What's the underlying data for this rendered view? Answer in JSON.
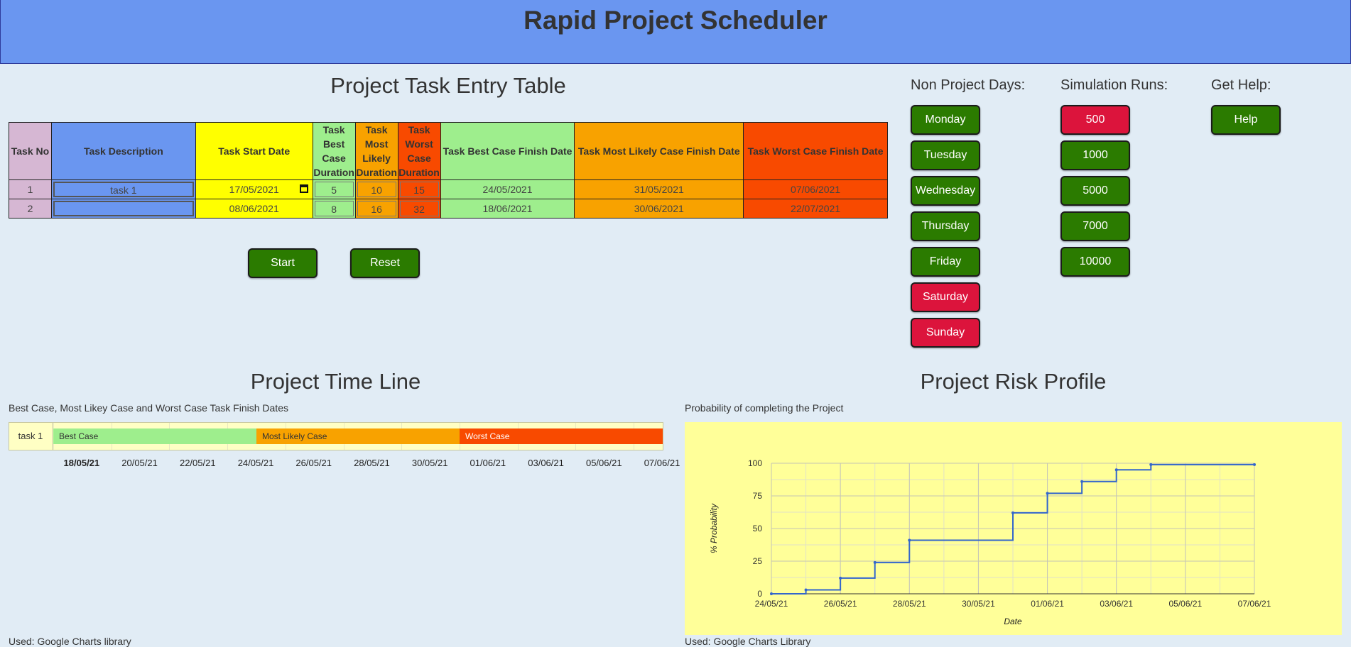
{
  "header": {
    "title": "Rapid Project Scheduler"
  },
  "task_table": {
    "title": "Project Task Entry Table",
    "columns": {
      "no": "Task No",
      "desc": "Task Description",
      "start": "Task Start Date",
      "best_l1": "Task",
      "best_l2": "Best",
      "best_l3": "Case",
      "best_l4": "Duration",
      "likely_l1": "Task",
      "likely_l2": "Most",
      "likely_l3": "Likely",
      "likely_l4": "Duration",
      "worst_l1": "Task",
      "worst_l2": "Worst",
      "worst_l3": "Case",
      "worst_l4": "Duration",
      "best_finish": "Task Best Case Finish Date",
      "likely_finish": "Task Most Likely Case Finish Date",
      "worst_finish": "Task Worst Case Finish Date"
    },
    "rows": [
      {
        "no": "1",
        "desc": "task 1",
        "start": "17/05/2021",
        "best": "5",
        "likely": "10",
        "worst": "15",
        "best_finish": "24/05/2021",
        "likely_finish": "31/05/2021",
        "worst_finish": "07/06/2021"
      },
      {
        "no": "2",
        "desc": "",
        "start": "08/06/2021",
        "best": "8",
        "likely": "16",
        "worst": "32",
        "best_finish": "18/06/2021",
        "likely_finish": "30/06/2021",
        "worst_finish": "22/07/2021"
      }
    ],
    "start_button": "Start",
    "reset_button": "Reset"
  },
  "non_project_days": {
    "title": "Non Project Days:",
    "days": [
      {
        "label": "Monday",
        "state": "on"
      },
      {
        "label": "Tuesday",
        "state": "on"
      },
      {
        "label": "Wednesday",
        "state": "on"
      },
      {
        "label": "Thursday",
        "state": "on"
      },
      {
        "label": "Friday",
        "state": "on"
      },
      {
        "label": "Saturday",
        "state": "off"
      },
      {
        "label": "Sunday",
        "state": "off"
      }
    ]
  },
  "simulation_runs": {
    "title": "Simulation Runs:",
    "options": [
      {
        "label": "500",
        "selected": true
      },
      {
        "label": "1000",
        "selected": false
      },
      {
        "label": "5000",
        "selected": false
      },
      {
        "label": "7000",
        "selected": false
      },
      {
        "label": "10000",
        "selected": false
      }
    ]
  },
  "help": {
    "title": "Get Help:",
    "button": "Help"
  },
  "timeline": {
    "title": "Project Time Line",
    "subtitle": "Best Case, Most Likey Case and Worst Case Task Finish Dates",
    "task_label": "task 1",
    "bars": [
      {
        "label": "Best Case",
        "start": "17/05/2021",
        "end": "24/05/2021",
        "color": "#9eee8d",
        "text_color": "#333333"
      },
      {
        "label": "Most Likely Case",
        "start": "24/05/2021",
        "end": "31/05/2021",
        "color": "#f8a200",
        "text_color": "#333333"
      },
      {
        "label": "Worst Case",
        "start": "31/05/2021",
        "end": "07/06/2021",
        "color": "#f84a00",
        "text_color": "#ffffff"
      }
    ],
    "axis_labels": [
      "18/05/21",
      "20/05/21",
      "22/05/21",
      "24/05/21",
      "26/05/21",
      "28/05/21",
      "30/05/21",
      "01/06/21",
      "03/06/21",
      "05/06/21",
      "07/06/21"
    ],
    "footer": "Used: Google Charts library"
  },
  "risk": {
    "title": "Project Risk Profile",
    "subtitle": "Probability of completing the Project",
    "footer": "Used: Google Charts Library"
  },
  "chart_data": {
    "type": "line",
    "title": "",
    "xlabel": "Date",
    "ylabel": "% Probability",
    "x_ticks": [
      "24/05/21",
      "26/05/21",
      "28/05/21",
      "30/05/21",
      "01/06/21",
      "03/06/21",
      "05/06/21",
      "07/06/21"
    ],
    "y_ticks": [
      0,
      25,
      50,
      75,
      100
    ],
    "ylim": [
      0,
      100
    ],
    "xlim": [
      "24/05/2021",
      "07/06/2021"
    ],
    "grid": true,
    "step": true,
    "line_color": "#3366cc",
    "background": "#ffff99",
    "series": [
      {
        "x": [
          "24/05/2021",
          "25/05/2021",
          "26/05/2021",
          "27/05/2021",
          "28/05/2021",
          "31/05/2021",
          "01/06/2021",
          "02/06/2021",
          "03/06/2021",
          "04/06/2021",
          "07/06/2021"
        ],
        "y": [
          0,
          3,
          12,
          24,
          41,
          62,
          77,
          86,
          95,
          99,
          99
        ]
      }
    ]
  }
}
